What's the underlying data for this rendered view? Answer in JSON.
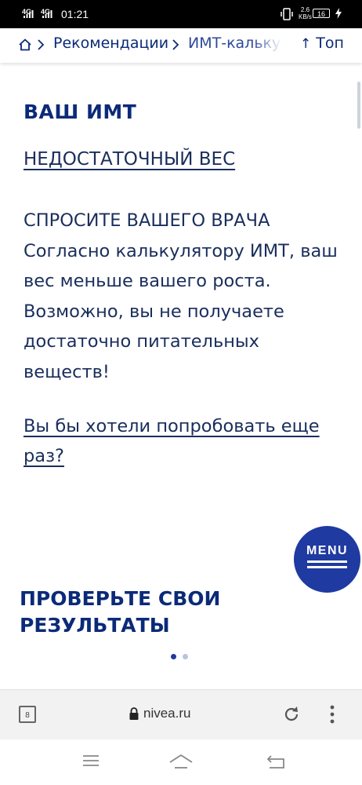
{
  "status_bar": {
    "network_1": "4G",
    "network_2": "4G",
    "time": "01:21",
    "speed_value": "2.6",
    "speed_unit": "KB/s",
    "battery": "16"
  },
  "breadcrumb": {
    "items": [
      "Рекомендации",
      "ИМТ-калькулятор"
    ],
    "top_label": "Топ"
  },
  "main": {
    "heading": "ВАШ ИМТ",
    "result_link": "НЕДОСТАТОЧНЫЙ ВЕС",
    "advice_title": "СПРОСИТЕ ВАШЕГО ВРАЧА",
    "advice_text": "Согласно калькулятору ИМТ, ваш вес меньше вашего роста. Возможно, вы не получаете достаточно питательных веществ!",
    "retry_link": "Вы бы хотели попробовать еще раз?",
    "section_title_line1": "ПРОВЕРЬТЕ СВОИ",
    "section_title_line2": "РЕЗУЛЬТАТЫ",
    "carousel_active_index": 0,
    "carousel_count": 2
  },
  "menu_button": {
    "label": "MENU"
  },
  "browser": {
    "tab_count": "8",
    "url": "nivea.ru"
  },
  "colors": {
    "brand_blue": "#0b2a78",
    "text": "#1a2e5c",
    "menu_bg": "#1f3aa0",
    "dot_active": "#1f3aa0",
    "dot_inactive": "#b9c4dd"
  },
  "icons": [
    "home-icon",
    "chevron-right-icon",
    "arrow-up-icon",
    "lock-icon",
    "reload-icon",
    "more-vert-icon",
    "menu-lines-icon",
    "home-nav-icon",
    "back-nav-icon"
  ]
}
